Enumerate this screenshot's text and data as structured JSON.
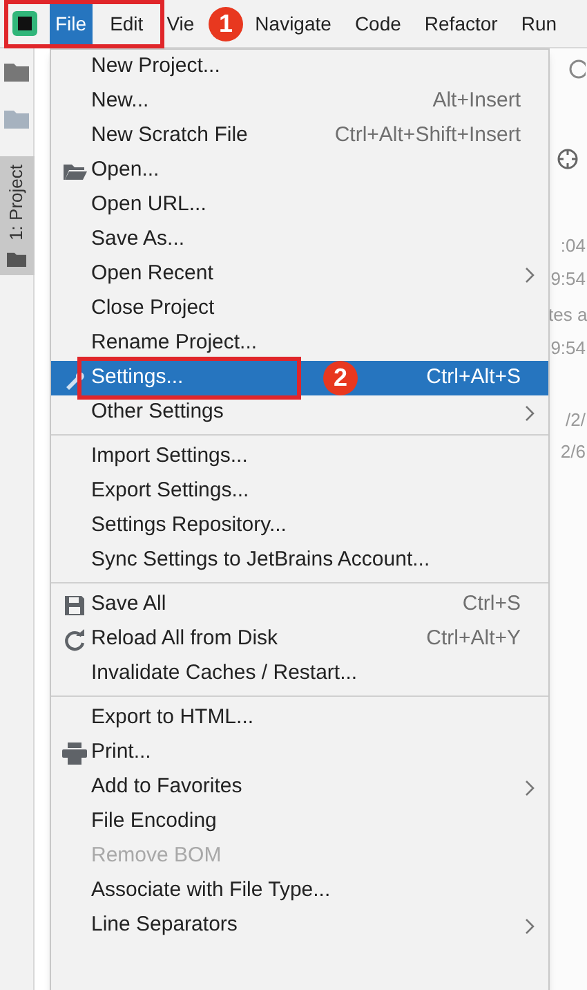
{
  "menu_bar": {
    "items": [
      {
        "label": "File",
        "selected": true
      },
      {
        "label": "Edit",
        "selected": false
      },
      {
        "label": "Vie",
        "selected": false
      },
      {
        "label": "Navigate",
        "selected": false
      },
      {
        "label": "Code",
        "selected": false
      },
      {
        "label": "Refactor",
        "selected": false
      },
      {
        "label": "Run",
        "selected": false
      }
    ]
  },
  "tool_window": {
    "label": "1: Project"
  },
  "background_texts": [
    ":04",
    "9:54",
    "tes a",
    "9:54",
    "/2/",
    "2/6"
  ],
  "file_menu": {
    "items": [
      {
        "kind": "item",
        "label": "New Project...",
        "selected": false,
        "disabled": false,
        "submenu": false
      },
      {
        "kind": "item",
        "label": "New...",
        "shortcut": "Alt+Insert",
        "selected": false,
        "disabled": false,
        "submenu": false
      },
      {
        "kind": "item",
        "label": "New Scratch File",
        "shortcut": "Ctrl+Alt+Shift+Insert",
        "selected": false,
        "disabled": false,
        "submenu": false
      },
      {
        "kind": "item",
        "label": "Open...",
        "selected": false,
        "disabled": false,
        "submenu": false
      },
      {
        "kind": "item",
        "label": "Open URL...",
        "selected": false,
        "disabled": false,
        "submenu": false
      },
      {
        "kind": "item",
        "label": "Save As...",
        "selected": false,
        "disabled": false,
        "submenu": false
      },
      {
        "kind": "item",
        "label": "Open Recent",
        "selected": false,
        "disabled": false,
        "submenu": true
      },
      {
        "kind": "item",
        "label": "Close Project",
        "selected": false,
        "disabled": false,
        "submenu": false
      },
      {
        "kind": "item",
        "label": "Rename Project...",
        "selected": false,
        "disabled": false,
        "submenu": false
      },
      {
        "kind": "item",
        "label": "Settings...",
        "shortcut": "Ctrl+Alt+S",
        "selected": true,
        "disabled": false,
        "submenu": false
      },
      {
        "kind": "item",
        "label": "Other Settings",
        "selected": false,
        "disabled": false,
        "submenu": true
      },
      {
        "kind": "separator"
      },
      {
        "kind": "item",
        "label": "Import Settings...",
        "selected": false,
        "disabled": false,
        "submenu": false
      },
      {
        "kind": "item",
        "label": "Export Settings...",
        "selected": false,
        "disabled": false,
        "submenu": false
      },
      {
        "kind": "item",
        "label": "Settings Repository...",
        "selected": false,
        "disabled": false,
        "submenu": false
      },
      {
        "kind": "item",
        "label": "Sync Settings to JetBrains Account...",
        "selected": false,
        "disabled": false,
        "submenu": false
      },
      {
        "kind": "separator"
      },
      {
        "kind": "item",
        "label": "Save All",
        "shortcut": "Ctrl+S",
        "selected": false,
        "disabled": false,
        "submenu": false
      },
      {
        "kind": "item",
        "label": "Reload All from Disk",
        "shortcut": "Ctrl+Alt+Y",
        "selected": false,
        "disabled": false,
        "submenu": false
      },
      {
        "kind": "item",
        "label": "Invalidate Caches / Restart...",
        "selected": false,
        "disabled": false,
        "submenu": false
      },
      {
        "kind": "separator"
      },
      {
        "kind": "item",
        "label": "Export to HTML...",
        "selected": false,
        "disabled": false,
        "submenu": false
      },
      {
        "kind": "item",
        "label": "Print...",
        "selected": false,
        "disabled": false,
        "submenu": false
      },
      {
        "kind": "item",
        "label": "Add to Favorites",
        "selected": false,
        "disabled": false,
        "submenu": true
      },
      {
        "kind": "item",
        "label": "File Encoding",
        "selected": false,
        "disabled": false,
        "submenu": false
      },
      {
        "kind": "item",
        "label": "Remove BOM",
        "selected": false,
        "disabled": true,
        "submenu": false
      },
      {
        "kind": "item",
        "label": "Associate with File Type...",
        "selected": false,
        "disabled": false,
        "submenu": false
      },
      {
        "kind": "item",
        "label": "Line Separators",
        "selected": false,
        "disabled": false,
        "submenu": true
      }
    ]
  },
  "annotations": [
    {
      "label": "1"
    },
    {
      "label": "2"
    }
  ]
}
